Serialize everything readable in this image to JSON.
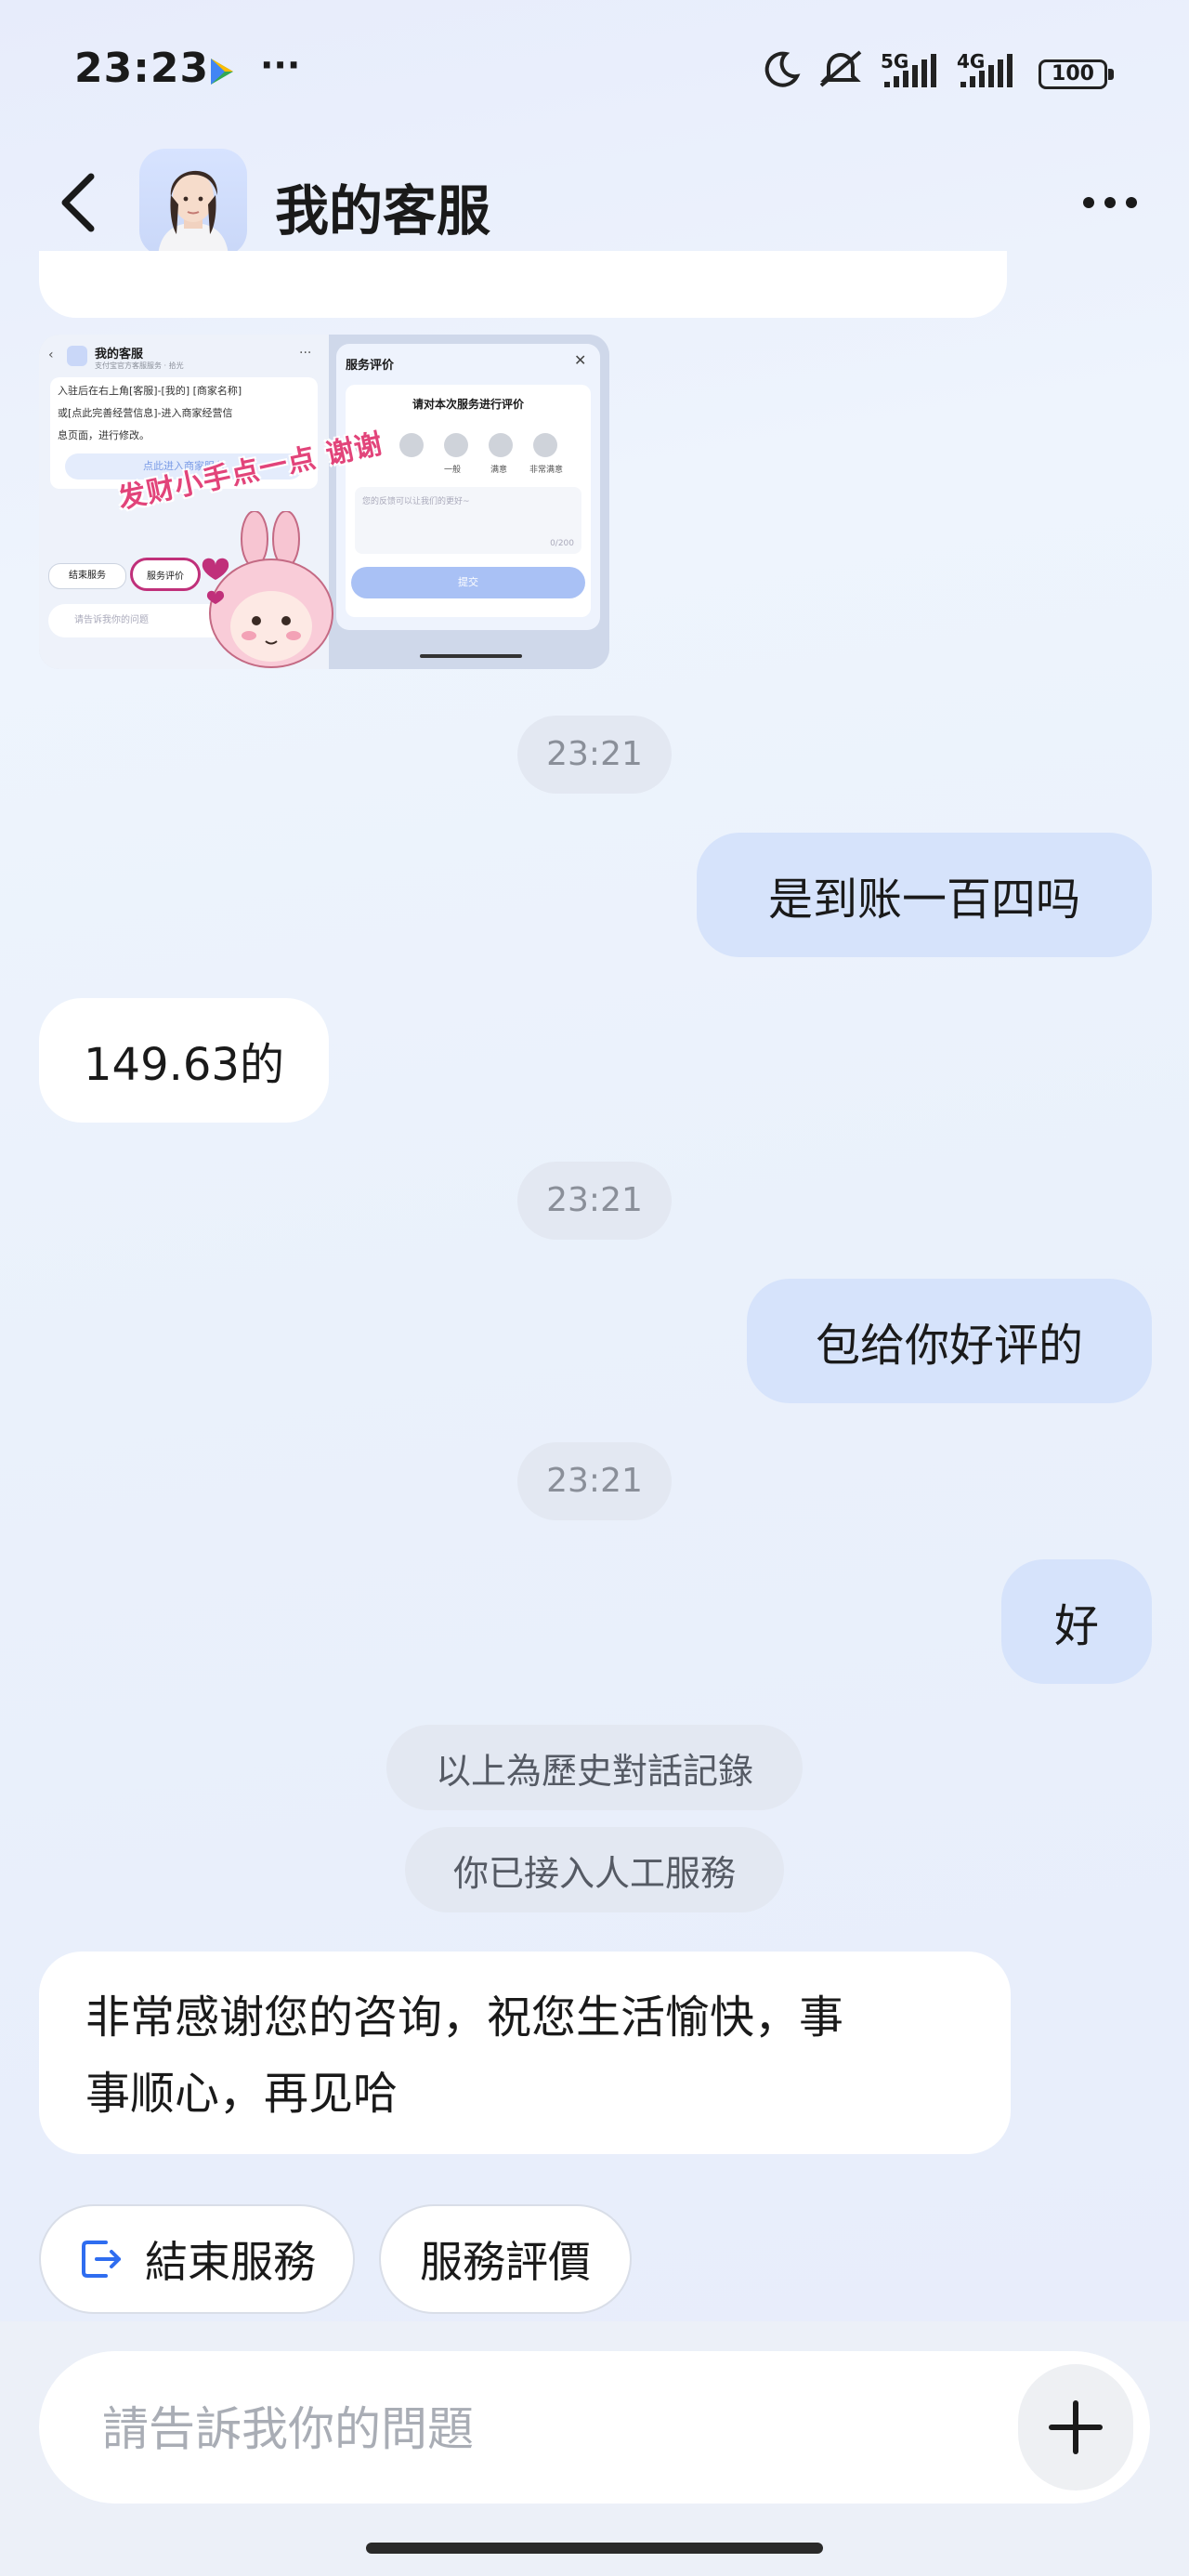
{
  "status_bar": {
    "time": "23:23",
    "ellipsis": "···",
    "signal_5g": "5G",
    "signal_4g": "4G",
    "battery": "100"
  },
  "header": {
    "title": "我的客服"
  },
  "image_card": {
    "mini_title": "我的客服",
    "mini_subtitle": "支付宝官方客服服务 · 拾光",
    "mini_text1": "入驻后在右上角[客服]-[我的] [商家名称]",
    "mini_text2": "或[点此完善经营信息]-进入商家经营信",
    "mini_text3": "息页面，进行修改。",
    "mini_link": "点此进入商家服务",
    "mini_end": "结束服务",
    "mini_rate": "服务评价",
    "mini_input": "请告诉我你的问题",
    "panel_title": "服务评价",
    "panel_question": "请对本次服务进行评价",
    "ratings": [
      "一般",
      "满意",
      "非常满意"
    ],
    "panel_placeholder": "您的反馈可以让我们的更好~",
    "panel_count": "0/200",
    "panel_submit": "提交",
    "sticker_text": "发财小手点一点 谢谢"
  },
  "messages": {
    "time1": "23:21",
    "msg_right1": "是到账一百四吗",
    "msg_left1": "149.63的",
    "time2": "23:21",
    "msg_right2": "包给你好评的",
    "time3": "23:21",
    "msg_right3": "好",
    "sys1": "以上為歷史對話記錄",
    "sys2": "你已接入人工服務",
    "msg_left2_line1": "非常感谢您的咨询，祝您生活愉快，事",
    "msg_left2_line2": "事顺心，再见哈"
  },
  "actions": {
    "end_service": "結束服務",
    "rate_service": "服務評價"
  },
  "input": {
    "placeholder": "請告訴我你的問題"
  }
}
